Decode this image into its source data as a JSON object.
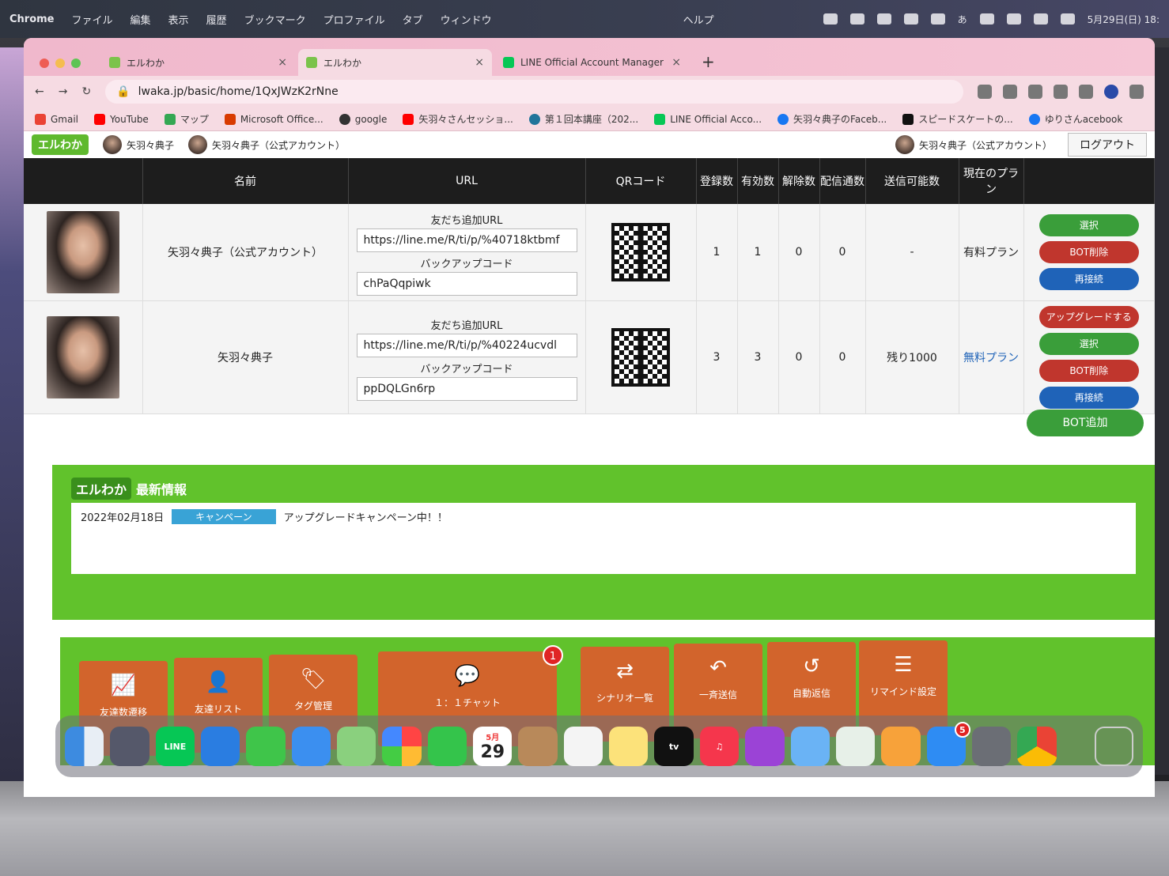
{
  "menubar": {
    "app": "Chrome",
    "items": [
      "ファイル",
      "編集",
      "表示",
      "履歴",
      "ブックマーク",
      "プロファイル",
      "タブ",
      "ウィンドウ",
      "ヘルプ"
    ],
    "clock": "5月29日(日) 18:",
    "ime": "あ"
  },
  "browser": {
    "tabs": [
      {
        "title": "エルわか",
        "close": "×"
      },
      {
        "title": "エルわか",
        "close": "×"
      },
      {
        "title": "LINE Official Account Manager",
        "close": "×"
      }
    ],
    "new_tab": "+",
    "url": "lwaka.jp/basic/home/1QxJWzK2rNne",
    "bookmarks": [
      "Gmail",
      "YouTube",
      "マップ",
      "Microsoft Office...",
      "google",
      "矢羽々さんセッショ...",
      "第１回本講座（202...",
      "LINE Official Acco...",
      "矢羽々典子のFaceb...",
      "スピードスケートの...",
      "ゆりさんacebook"
    ]
  },
  "site": {
    "logo": "エルわか",
    "accounts": [
      "矢羽々典子",
      "矢羽々典子（公式アカウント）"
    ],
    "current_account": "矢羽々典子（公式アカウント）",
    "logout": "ログアウト"
  },
  "table": {
    "headers": [
      "名前",
      "URL",
      "QRコード",
      "登録数",
      "有効数",
      "解除数",
      "配信通数",
      "送信可能数",
      "現在のプラン"
    ],
    "url_label": "友だち追加URL",
    "backup_label": "バックアップコード",
    "rows": [
      {
        "name": "矢羽々典子（公式アカウント）",
        "url": "https://line.me/R/ti/p/%40718ktbmf",
        "backup": "chPaQqpiwk",
        "registered": "1",
        "active": "1",
        "cancelled": "0",
        "delivered": "0",
        "sendable": "-",
        "plan": "有料プラン",
        "buttons": [
          "選択",
          "BOT削除",
          "再接続"
        ]
      },
      {
        "name": "矢羽々典子",
        "url": "https://line.me/R/ti/p/%40224ucvdl",
        "backup": "ppDQLGn6rp",
        "registered": "3",
        "active": "3",
        "cancelled": "0",
        "delivered": "0",
        "sendable": "残り1000",
        "plan": "無料プラン",
        "buttons": [
          "アップグレードする",
          "選択",
          "BOT削除",
          "再接続"
        ]
      }
    ],
    "bot_add": "BOT追加"
  },
  "news": {
    "title": "最新情報",
    "date": "2022年02月18日",
    "tag": "キャンペーン",
    "text": "アップグレードキャンペーン中！！"
  },
  "menu": [
    {
      "label": "友達数遷移",
      "icon": "chart-icon"
    },
    {
      "label": "友達リスト",
      "icon": "person-icon"
    },
    {
      "label": "タグ管理",
      "icon": "tag-icon"
    },
    {
      "label": "１：１チャット",
      "icon": "chat-icon",
      "badge": "1"
    },
    {
      "label": "シナリオ一覧",
      "icon": "shuffle-icon"
    },
    {
      "label": "一斉送信",
      "icon": "reply-icon"
    },
    {
      "label": "自動返信",
      "icon": "undo-icon"
    },
    {
      "label": "リマインド設定",
      "icon": "list-icon"
    }
  ],
  "dock": {
    "calendar_month": "5月",
    "calendar_day": "29",
    "appstore_badge": "5",
    "tv_label": "tv"
  }
}
